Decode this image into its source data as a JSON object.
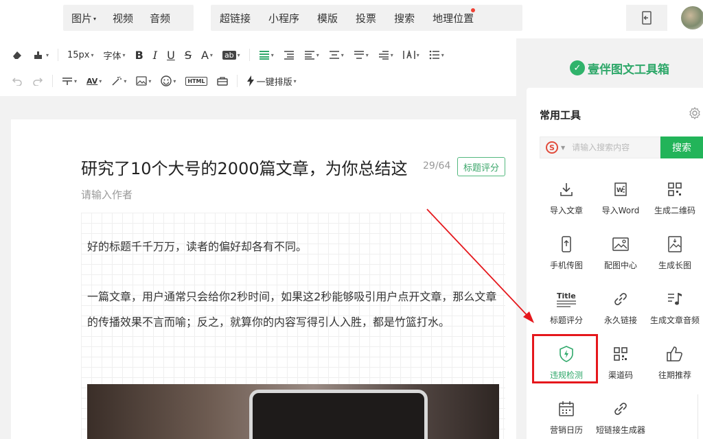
{
  "topbar": {
    "group1": [
      "图片",
      "视频",
      "音频"
    ],
    "group2": [
      "超链接",
      "小程序",
      "模版",
      "投票",
      "搜索",
      "地理位置"
    ]
  },
  "toolbar": {
    "font_size": "15px",
    "font_family": "字体",
    "one_click_layout": "一键排版"
  },
  "article": {
    "title": "研究了10个大号的2000篇文章，为你总结这",
    "title_count": "29/64",
    "title_score_button": "标题评分",
    "author_placeholder": "请输入作者",
    "paragraph1": "好的标题千千万万，读者的偏好却各有不同。",
    "paragraph2": "一篇文章，用户通常只会给你2秒时间，如果这2秒能够吸引用户点开文章，那么文章的传播效果不言而喻；反之，就算你的内容写得引人入胜，都是竹篮打水。"
  },
  "panel": {
    "brand": "壹伴图文工具箱",
    "section_title": "常用工具",
    "search_placeholder": "请输入搜索内容",
    "search_button": "搜索",
    "tools": [
      {
        "label": "导入文章",
        "icon": "download-icon"
      },
      {
        "label": "导入Word",
        "icon": "word-icon"
      },
      {
        "label": "生成二维码",
        "icon": "qrcode-icon"
      },
      {
        "label": "手机传图",
        "icon": "phone-upload-icon"
      },
      {
        "label": "配图中心",
        "icon": "image-icon"
      },
      {
        "label": "生成长图",
        "icon": "long-image-icon"
      },
      {
        "label": "标题评分",
        "icon": "title-icon"
      },
      {
        "label": "永久链接",
        "icon": "link-icon"
      },
      {
        "label": "生成文章音频",
        "icon": "music-icon"
      },
      {
        "label": "违规检测",
        "icon": "shield-icon"
      },
      {
        "label": "渠道码",
        "icon": "channel-qr-icon"
      },
      {
        "label": "往期推荐",
        "icon": "thumbs-up-icon"
      },
      {
        "label": "营销日历",
        "icon": "calendar-icon"
      },
      {
        "label": "短链接生成器",
        "icon": "short-link-icon"
      }
    ]
  },
  "colors": {
    "brand_green": "#2fa86a",
    "search_green": "#22b459",
    "highlight_red": "#e5171c"
  }
}
